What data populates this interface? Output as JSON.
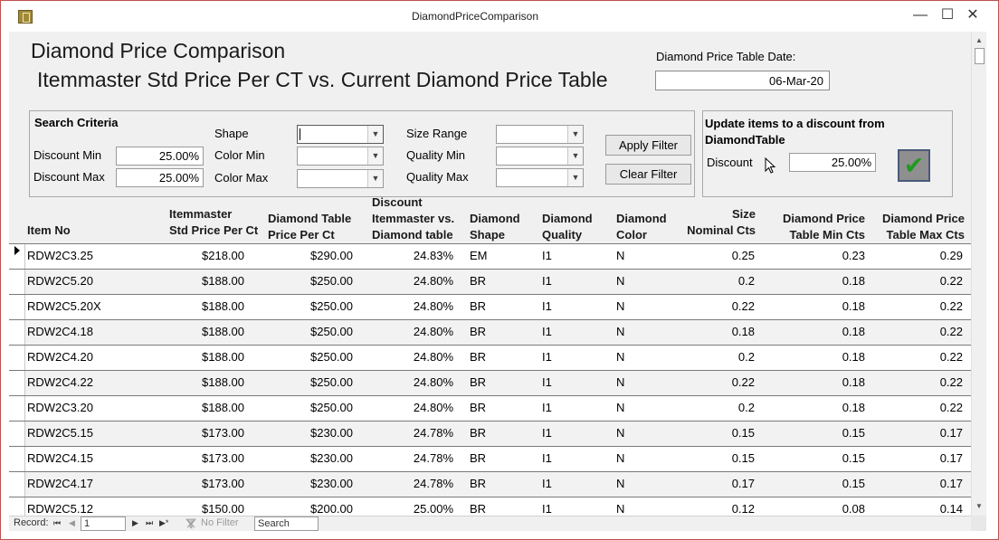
{
  "window": {
    "title": "DiamondPriceComparison",
    "minimize": "—",
    "maximize": "☐",
    "close": "✕"
  },
  "header": {
    "title_line1": "Diamond Price Comparison",
    "title_line2": "Itemmaster Std Price Per CT vs. Current Diamond Price Table",
    "date_label": "Diamond Price Table Date:",
    "date_value": "06-Mar-20"
  },
  "search": {
    "title": "Search Criteria",
    "discount_min_label": "Discount Min",
    "discount_min_value": "25.00%",
    "discount_max_label": "Discount Max",
    "discount_max_value": "25.00%",
    "shape_label": "Shape",
    "color_min_label": "Color Min",
    "color_max_label": "Color Max",
    "size_range_label": "Size Range",
    "quality_min_label": "Quality Min",
    "quality_max_label": "Quality Max",
    "apply_filter": "Apply Filter",
    "clear_filter": "Clear Filter"
  },
  "update": {
    "title_line1": "Update items  to a discount from",
    "title_line2": "DiamondTable",
    "discount_label": "Discount",
    "discount_value": "25.00%",
    "confirm_icon": "✔"
  },
  "table": {
    "headers": {
      "item_no": "Item No",
      "std_price_1": "Itemmaster",
      "std_price_2": "Std Price Per Ct",
      "table_price_1": "Diamond Table",
      "table_price_2": "Price Per Ct",
      "discount_1": "Discount",
      "discount_2": "Itemmaster vs.",
      "discount_3": "Diamond table",
      "shape_1": "Diamond",
      "shape_2": "Shape",
      "quality_1": "Diamond",
      "quality_2": "Quality",
      "color_1": "Diamond",
      "color_2": "Color",
      "size_1": "Size",
      "size_2": "Nominal Cts",
      "min_1": "Diamond Price",
      "min_2": "Table Min Cts",
      "max_1": "Diamond Price",
      "max_2": "Table Max Cts"
    },
    "rows": [
      {
        "item": "RDW2C3.25",
        "std": "$218.00",
        "tbl": "$290.00",
        "disc": "24.83%",
        "shape": "EM",
        "quality": "I1",
        "color": "N",
        "size": "0.25",
        "min": "0.23",
        "max": "0.29"
      },
      {
        "item": "RDW2C5.20",
        "std": "$188.00",
        "tbl": "$250.00",
        "disc": "24.80%",
        "shape": "BR",
        "quality": "I1",
        "color": "N",
        "size": "0.2",
        "min": "0.18",
        "max": "0.22"
      },
      {
        "item": "RDW2C5.20X",
        "std": "$188.00",
        "tbl": "$250.00",
        "disc": "24.80%",
        "shape": "BR",
        "quality": "I1",
        "color": "N",
        "size": "0.22",
        "min": "0.18",
        "max": "0.22"
      },
      {
        "item": "RDW2C4.18",
        "std": "$188.00",
        "tbl": "$250.00",
        "disc": "24.80%",
        "shape": "BR",
        "quality": "I1",
        "color": "N",
        "size": "0.18",
        "min": "0.18",
        "max": "0.22"
      },
      {
        "item": "RDW2C4.20",
        "std": "$188.00",
        "tbl": "$250.00",
        "disc": "24.80%",
        "shape": "BR",
        "quality": "I1",
        "color": "N",
        "size": "0.2",
        "min": "0.18",
        "max": "0.22"
      },
      {
        "item": "RDW2C4.22",
        "std": "$188.00",
        "tbl": "$250.00",
        "disc": "24.80%",
        "shape": "BR",
        "quality": "I1",
        "color": "N",
        "size": "0.22",
        "min": "0.18",
        "max": "0.22"
      },
      {
        "item": "RDW2C3.20",
        "std": "$188.00",
        "tbl": "$250.00",
        "disc": "24.80%",
        "shape": "BR",
        "quality": "I1",
        "color": "N",
        "size": "0.2",
        "min": "0.18",
        "max": "0.22"
      },
      {
        "item": "RDW2C5.15",
        "std": "$173.00",
        "tbl": "$230.00",
        "disc": "24.78%",
        "shape": "BR",
        "quality": "I1",
        "color": "N",
        "size": "0.15",
        "min": "0.15",
        "max": "0.17"
      },
      {
        "item": "RDW2C4.15",
        "std": "$173.00",
        "tbl": "$230.00",
        "disc": "24.78%",
        "shape": "BR",
        "quality": "I1",
        "color": "N",
        "size": "0.15",
        "min": "0.15",
        "max": "0.17"
      },
      {
        "item": "RDW2C4.17",
        "std": "$173.00",
        "tbl": "$230.00",
        "disc": "24.78%",
        "shape": "BR",
        "quality": "I1",
        "color": "N",
        "size": "0.17",
        "min": "0.15",
        "max": "0.17"
      },
      {
        "item": "RDW2C5.12",
        "std": "$150.00",
        "tbl": "$200.00",
        "disc": "25.00%",
        "shape": "BR",
        "quality": "I1",
        "color": "N",
        "size": "0.12",
        "min": "0.08",
        "max": "0.14"
      }
    ]
  },
  "navbar": {
    "record_label": "Record:",
    "record_value": "1",
    "first_icon": "⏮",
    "prev_icon": "◀",
    "next_icon": "▶",
    "last_icon": "⏭",
    "new_icon": "▶*",
    "no_filter": "No Filter",
    "search": "Search"
  }
}
